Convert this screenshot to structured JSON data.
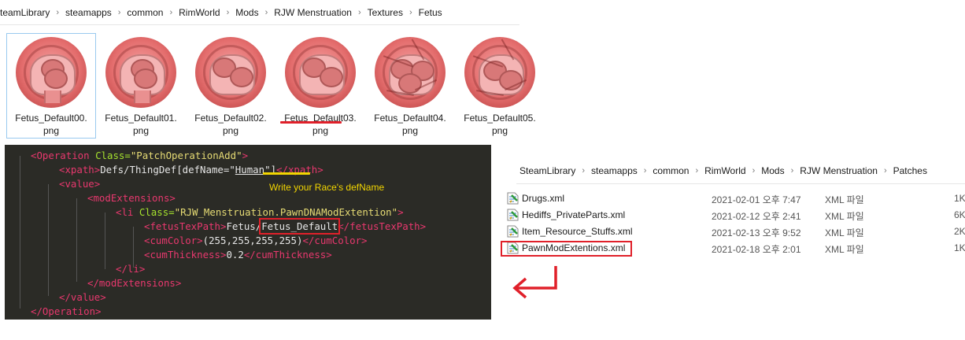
{
  "top_breadcrumb": [
    "SteamLibrary",
    "steamapps",
    "common",
    "RimWorld",
    "Mods",
    "RJW Menstruation",
    "Textures",
    "Fetus"
  ],
  "thumbnails": [
    {
      "name": "Fetus_Default00.\npng",
      "line1": "Fetus_Default00.",
      "line2": "png",
      "variant": "clean",
      "selected": true
    },
    {
      "name": "Fetus_Default01.png",
      "line1": "Fetus_Default01.",
      "line2": "png",
      "variant": "clean"
    },
    {
      "name": "Fetus_Default02.png",
      "line1": "Fetus_Default02.",
      "line2": "png",
      "variant": "mid"
    },
    {
      "name": "Fetus_Default03.png",
      "line1": "Fetus_Default03.",
      "line2": "png",
      "variant": "mid",
      "underlined": true
    },
    {
      "name": "Fetus_Default04.png",
      "line1": "Fetus_Default04.",
      "line2": "png",
      "variant": "late"
    },
    {
      "name": "Fetus_Default05.png",
      "line1": "Fetus_Default05.",
      "line2": "png",
      "variant": "cracked"
    }
  ],
  "code": {
    "l1_open": "<Operation",
    "l1_attr": " Class=",
    "l1_str": "\"PatchOperationAdd\"",
    "l1_close": ">",
    "l2_open": "<xpath>",
    "l2_text_a": "Defs/ThingDef[defName=\"",
    "l2_human": "Human",
    "l2_text_b": "\"]",
    "l2_close": "</xpath>",
    "hint": "Write your Race's defName",
    "l3": "<value>",
    "l4": "<modExtensions>",
    "l5_open": "<li",
    "l5_attr": " Class=",
    "l5_str": "\"RJW_Menstruation.PawnDNAModExtention\"",
    "l5_close": ">",
    "l6_open": "<fetusTexPath>",
    "l6_text_a": "Fetus/",
    "l6_boxed": "Fetus_Default",
    "l6_close": "</fetusTexPath>",
    "l7_open": "<cumColor>",
    "l7_text": "(255,255,255,255)",
    "l7_close": "</cumColor>",
    "l8_open": "<cumThickness>",
    "l8_text": "0.2",
    "l8_close": "</cumThickness>",
    "l9": "</li>",
    "l10": "</modExtensions>",
    "l11": "</value>",
    "l12": "</Operation>"
  },
  "right_breadcrumb": [
    "SteamLibrary",
    "steamapps",
    "common",
    "RimWorld",
    "Mods",
    "RJW Menstruation",
    "Patches"
  ],
  "files": [
    {
      "name": "Drugs.xml",
      "date": "2021-02-01 오후 7:47",
      "type": "XML 파일",
      "size": "1K"
    },
    {
      "name": "Hediffs_PrivateParts.xml",
      "date": "2021-02-12 오후 2:41",
      "type": "XML 파일",
      "size": "6K"
    },
    {
      "name": "Item_Resource_Stuffs.xml",
      "date": "2021-02-13 오후 9:52",
      "type": "XML 파일",
      "size": "2K"
    },
    {
      "name": "PawnModExtentions.xml",
      "date": "2021-02-18 오후 2:01",
      "type": "XML 파일",
      "size": "1K",
      "highlighted": true
    }
  ],
  "colors": {
    "annotation_red": "#e0202a",
    "annotation_yellow": "#f2d500",
    "code_bg": "#2b2b26"
  }
}
